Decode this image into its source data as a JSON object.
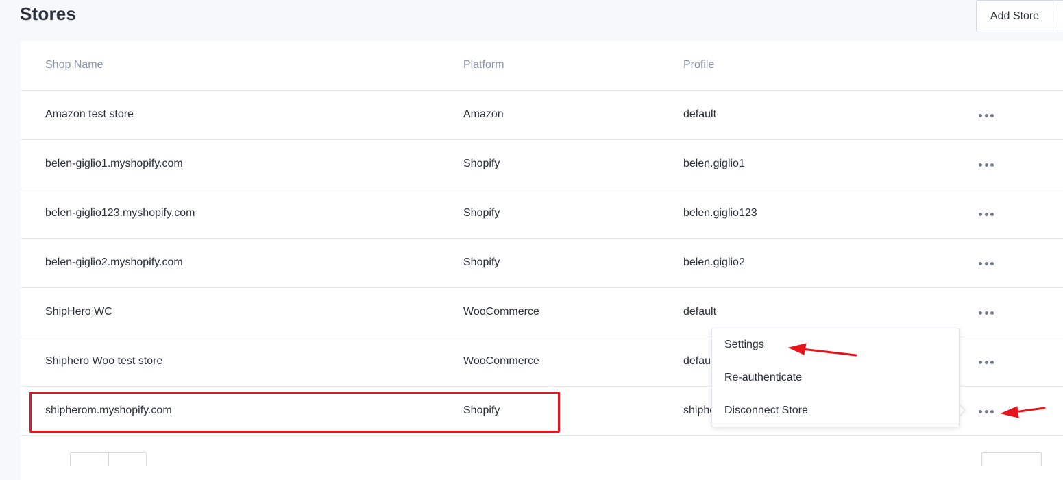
{
  "page": {
    "title": "Stores",
    "add_store_label": "Add Store"
  },
  "table": {
    "headers": {
      "shop_name": "Shop Name",
      "platform": "Platform",
      "profile": "Profile"
    },
    "rows": [
      {
        "shop_name": "Amazon test store",
        "platform": "Amazon",
        "profile": "default"
      },
      {
        "shop_name": "belen-giglio1.myshopify.com",
        "platform": "Shopify",
        "profile": "belen.giglio1"
      },
      {
        "shop_name": "belen-giglio123.myshopify.com",
        "platform": "Shopify",
        "profile": "belen.giglio123"
      },
      {
        "shop_name": "belen-giglio2.myshopify.com",
        "platform": "Shopify",
        "profile": "belen.giglio2"
      },
      {
        "shop_name": "ShipHero WC",
        "platform": "WooCommerce",
        "profile": "default"
      },
      {
        "shop_name": "Shiphero Woo test store",
        "platform": "WooCommerce",
        "profile": "default"
      },
      {
        "shop_name": "shipherom.myshopify.com",
        "platform": "Shopify",
        "profile": "shipherom"
      }
    ]
  },
  "dropdown": {
    "items": [
      "Settings",
      "Re-authenticate",
      "Disconnect Store"
    ]
  },
  "colors": {
    "annotation_red": "#e8141b",
    "header_text": "#8a93a3",
    "body_text": "#2a2f3a"
  },
  "icons": {
    "row_actions": "more-horizontal-icon"
  }
}
